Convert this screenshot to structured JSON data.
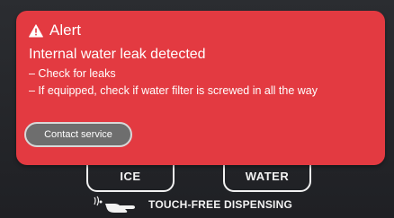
{
  "alert": {
    "title": "Alert",
    "message": "Internal water leak detected",
    "lines": [
      "– Check for leaks",
      "– If equipped, check if water filter is screwed in all the way"
    ],
    "contact_button": "Contact service",
    "icon": "warning-triangle-icon",
    "color": "#e33a41"
  },
  "controls": {
    "ice_label": "ICE",
    "water_label": "WATER",
    "touch_free_label": "TOUCH-FREE DISPENSING",
    "touch_free_icon": "hand-wave-icon"
  }
}
